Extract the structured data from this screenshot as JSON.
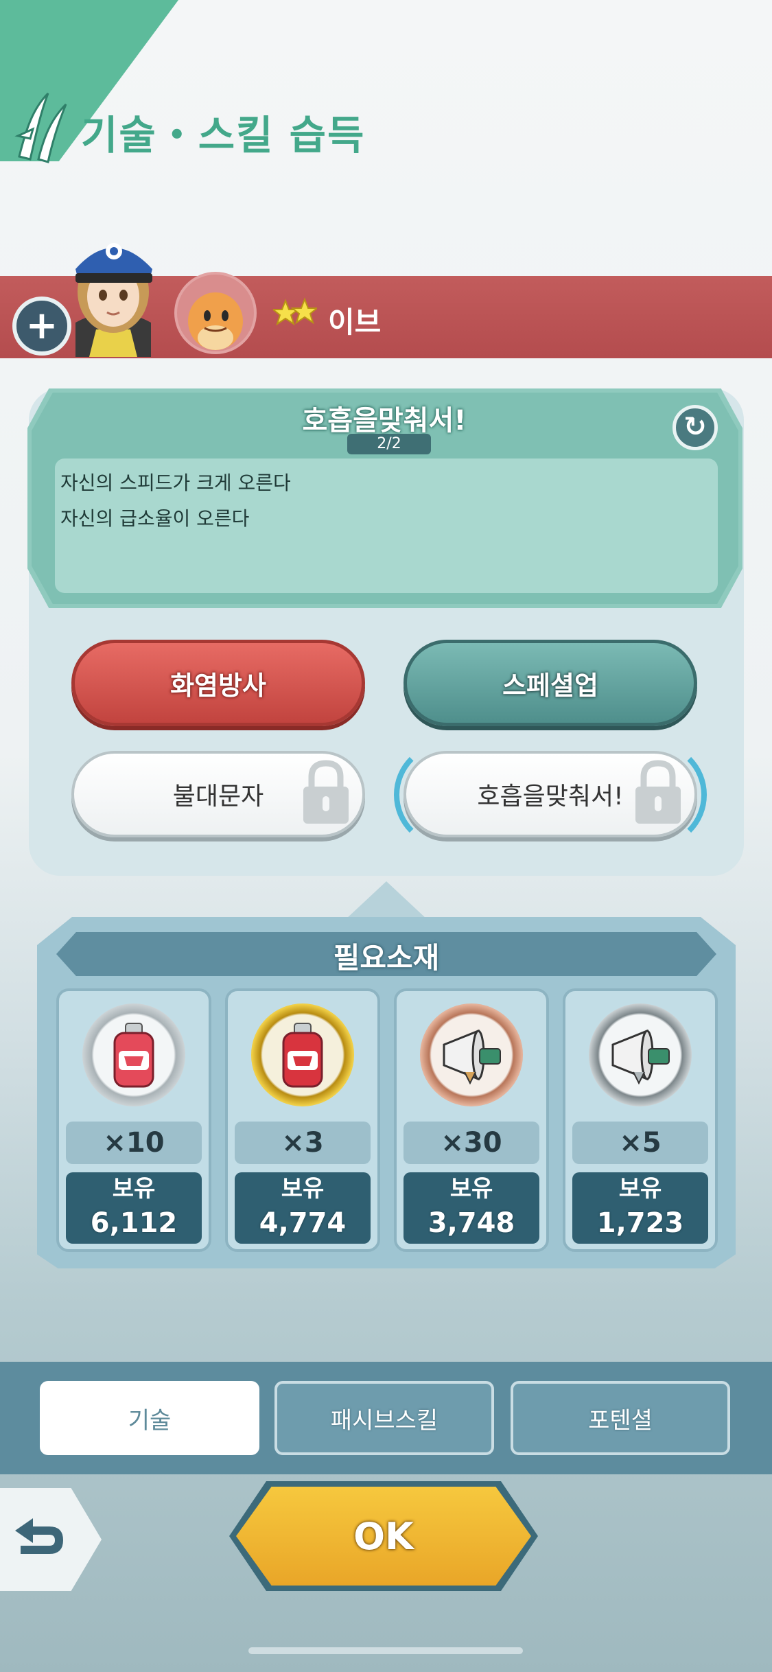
{
  "header": {
    "title": "기술・스킬 습득",
    "icon": "claw-slash-icon"
  },
  "character": {
    "add_icon": "+",
    "star_count": 2,
    "pokemon_name": "이브"
  },
  "move_detail": {
    "title": "호흡을맞춰서!",
    "page": "2/2",
    "refresh_icon": "↻",
    "description": [
      "자신의 스피드가 크게 오른다",
      "자신의 급소율이 오른다"
    ]
  },
  "moves": [
    {
      "label": "화염방사",
      "type": "fire",
      "locked": false
    },
    {
      "label": "스페셜업",
      "type": "normal",
      "locked": false
    },
    {
      "label": "불대문자",
      "type": "locked",
      "locked": true
    },
    {
      "label": "호흡을맞춰서!",
      "type": "locked",
      "locked": true,
      "selected": true
    }
  ],
  "materials": {
    "title": "필요소재",
    "own_label": "보유",
    "items": [
      {
        "icon": "red-drink-bottle-icon",
        "required": "×10",
        "owned": "6,112"
      },
      {
        "icon": "gold-drink-bottle-icon",
        "required": "×3",
        "owned": "4,774"
      },
      {
        "icon": "bronze-megaphone-icon",
        "required": "×30",
        "owned": "3,748"
      },
      {
        "icon": "silver-megaphone-icon",
        "required": "×5",
        "owned": "1,723"
      }
    ]
  },
  "tabs": [
    {
      "label": "기술",
      "active": true
    },
    {
      "label": "패시브스킬",
      "active": false
    },
    {
      "label": "포텐셜",
      "active": false
    }
  ],
  "footer": {
    "back_icon": "return-arrow-icon",
    "ok_label": "OK"
  },
  "colors": {
    "accent": "#43a88a",
    "banner": "#b84f51",
    "fire": "#d2514b",
    "normal": "#5e9c98",
    "ok": "#f0b632"
  }
}
